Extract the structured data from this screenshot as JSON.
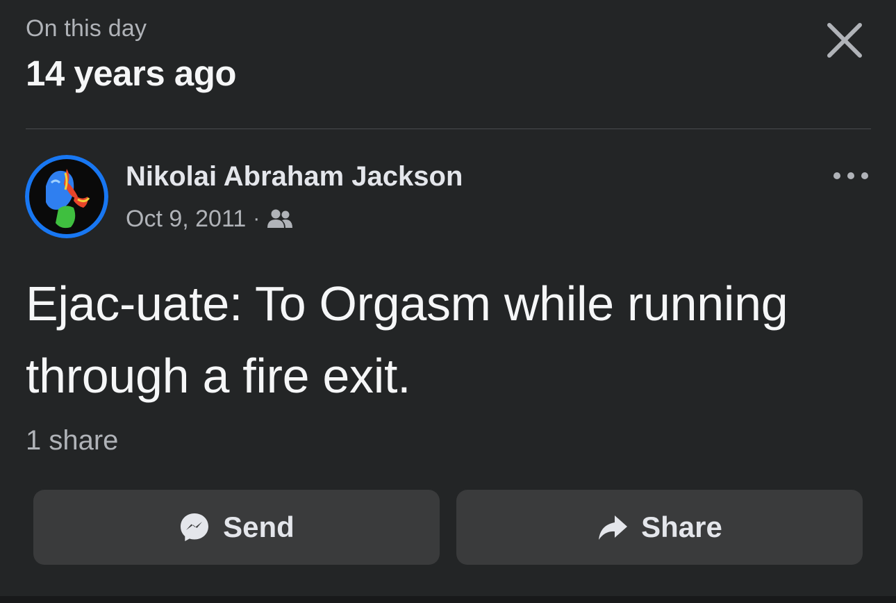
{
  "header": {
    "kicker": "On this day",
    "title": "14 years ago"
  },
  "post": {
    "author": "Nikolai Abraham Jackson",
    "date": "Oct 9, 2011",
    "separator": "·",
    "audience_icon": "friends-icon",
    "text": "Ejac-uate: To Orgasm while running through a fire exit.",
    "share_count": "1 share"
  },
  "actions": {
    "send_label": "Send",
    "share_label": "Share"
  },
  "icons": {
    "close": "close-icon",
    "more": "more-horizontal-icon",
    "send": "messenger-icon",
    "share": "share-arrow-icon"
  },
  "colors": {
    "background": "#232526",
    "button_background": "#3a3b3c",
    "primary_text": "#e4e6eb",
    "secondary_text": "#b0b3b8",
    "avatar_ring": "#1877f2"
  }
}
